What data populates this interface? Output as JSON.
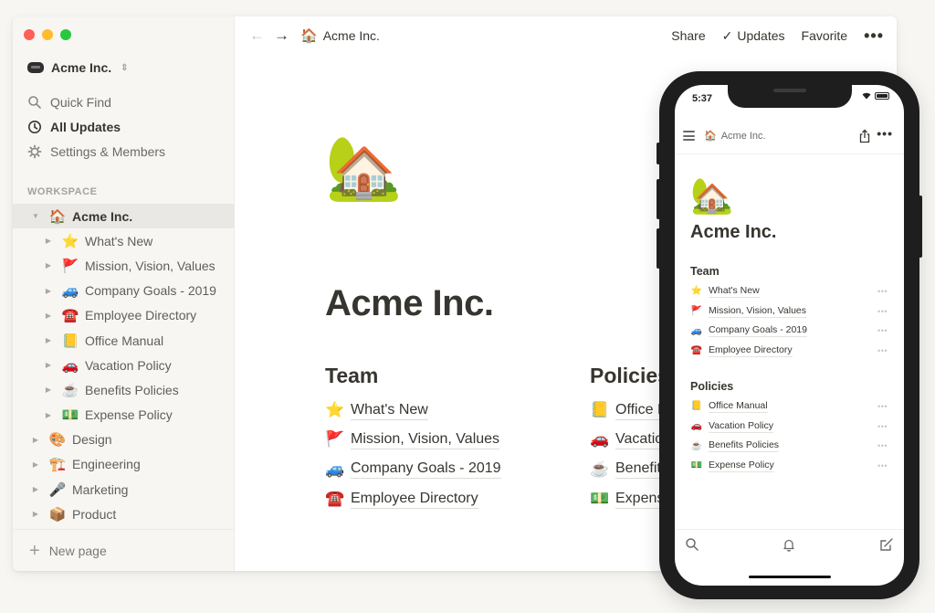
{
  "sidebar": {
    "workspace_name": "Acme Inc.",
    "nav": [
      {
        "icon": "search-icon",
        "label": "Quick Find"
      },
      {
        "icon": "clock-icon",
        "label": "All Updates"
      },
      {
        "icon": "gear-icon",
        "label": "Settings & Members"
      }
    ],
    "section_label": "WORKSPACE",
    "tree": [
      {
        "emoji": "🏠",
        "label": "Acme Inc.",
        "level": 0,
        "expanded": true,
        "active": true
      },
      {
        "emoji": "⭐",
        "label": "What's New",
        "level": 1
      },
      {
        "emoji": "🚩",
        "label": "Mission, Vision, Values",
        "level": 1
      },
      {
        "emoji": "🚙",
        "label": "Company Goals - 2019",
        "level": 1
      },
      {
        "emoji": "☎️",
        "label": "Employee Directory",
        "level": 1
      },
      {
        "emoji": "📒",
        "label": "Office Manual",
        "level": 1
      },
      {
        "emoji": "🚗",
        "label": "Vacation Policy",
        "level": 1
      },
      {
        "emoji": "☕",
        "label": "Benefits Policies",
        "level": 1
      },
      {
        "emoji": "💵",
        "label": "Expense Policy",
        "level": 1
      },
      {
        "emoji": "🎨",
        "label": "Design",
        "level": 0
      },
      {
        "emoji": "🏗️",
        "label": "Engineering",
        "level": 0
      },
      {
        "emoji": "🎤",
        "label": "Marketing",
        "level": 0
      },
      {
        "emoji": "📦",
        "label": "Product",
        "level": 0
      }
    ],
    "new_page_label": "New page"
  },
  "topbar": {
    "breadcrumb_emoji": "🏠",
    "breadcrumb_label": "Acme Inc.",
    "share_label": "Share",
    "updates_label": "Updates",
    "favorite_label": "Favorite",
    "more_label": "•••"
  },
  "page": {
    "icon": "🏡",
    "title": "Acme Inc.",
    "team": {
      "heading": "Team",
      "links": [
        {
          "emoji": "⭐",
          "label": "What's New"
        },
        {
          "emoji": "🚩",
          "label": "Mission, Vision, Values"
        },
        {
          "emoji": "🚙",
          "label": "Company Goals - 2019"
        },
        {
          "emoji": "☎️",
          "label": "Employee Directory"
        }
      ]
    },
    "policies": {
      "heading": "Policies",
      "links": [
        {
          "emoji": "📒",
          "label": "Office Manual"
        },
        {
          "emoji": "🚗",
          "label": "Vacation Policy"
        },
        {
          "emoji": "☕",
          "label": "Benefits Policies"
        },
        {
          "emoji": "💵",
          "label": "Expense Policy"
        }
      ]
    }
  },
  "mobile": {
    "status_time": "5:37",
    "breadcrumb_emoji": "🏠",
    "breadcrumb_label": "Acme Inc.",
    "more_label": "•••",
    "icon": "🏡",
    "title": "Acme Inc.",
    "team": {
      "heading": "Team",
      "links": [
        {
          "emoji": "⭐",
          "label": "What's New"
        },
        {
          "emoji": "🚩",
          "label": "Mission, Vision, Values"
        },
        {
          "emoji": "🚙",
          "label": "Company Goals - 2019"
        },
        {
          "emoji": "☎️",
          "label": "Employee Directory"
        }
      ]
    },
    "policies": {
      "heading": "Policies",
      "links": [
        {
          "emoji": "📒",
          "label": "Office Manual"
        },
        {
          "emoji": "🚗",
          "label": "Vacation Policy"
        },
        {
          "emoji": "☕",
          "label": "Benefits Policies"
        },
        {
          "emoji": "💵",
          "label": "Expense Policy"
        }
      ]
    },
    "row_more_label": "•••"
  },
  "colors": {
    "background": "#f7f6f3",
    "sidebar": "#f7f6f3",
    "text": "#37352f",
    "traffic_red": "#fe5f57",
    "traffic_yellow": "#febc2e",
    "traffic_green": "#28c840",
    "phone_frame": "#1e1e1e"
  }
}
